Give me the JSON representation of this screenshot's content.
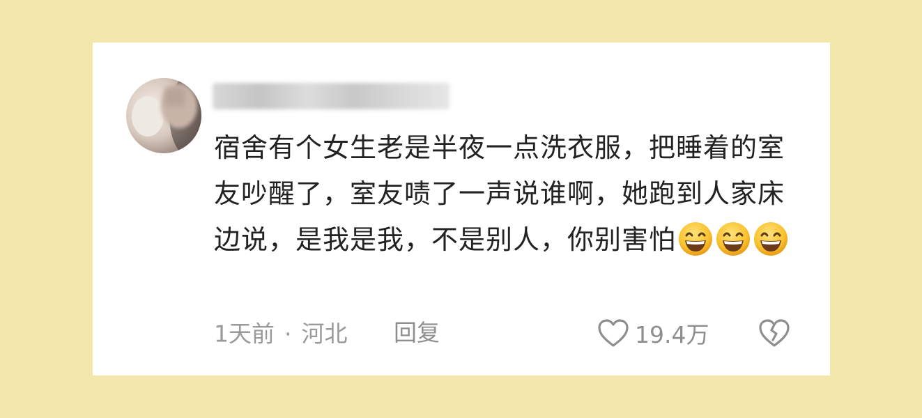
{
  "comment": {
    "username": "",
    "text": "宿舍有个女生老是半夜一点洗衣服，把睡着的室友吵醒了，室友啧了一声说谁啊，她跑到人家床边说，是我是我，不是别人，你别害怕",
    "emojis": [
      "grinning-face-emoji",
      "grinning-face-emoji",
      "grinning-face-emoji"
    ],
    "time": "1天前",
    "separator": "·",
    "location": "河北",
    "reply_label": "回复",
    "like_count": "19.4万"
  },
  "colors": {
    "background": "#f3e7ac",
    "card": "#ffffff",
    "text": "#222222",
    "meta": "#9a9a9a"
  }
}
